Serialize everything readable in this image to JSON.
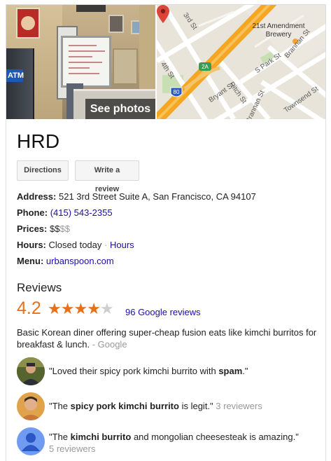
{
  "media": {
    "see_photos_label": "See photos",
    "atm_label": "ATM",
    "map": {
      "street_labels": [
        "3rd St",
        "4th St",
        "Bryant St",
        "Ritch St",
        "Brannan St",
        "S Park St",
        "Brannan St",
        "Townsend St"
      ],
      "place_name_line1": "21st Amendment",
      "place_name_line2": "Brewery",
      "highway_shield": "80",
      "route_shield": "2A"
    }
  },
  "business": {
    "name": "HRD",
    "actions": {
      "directions_label": "Directions",
      "write_review_label": "Write a review"
    },
    "address_label": "Address:",
    "address_value": "521 3rd Street Suite A, San Francisco, CA 94107",
    "phone_label": "Phone:",
    "phone_value": "(415) 543-2355",
    "prices_label": "Prices:",
    "prices_active": "$$",
    "prices_inactive": "$$",
    "hours_label": "Hours:",
    "hours_value": "Closed today",
    "hours_sep": "·",
    "hours_link": "Hours",
    "menu_label": "Menu:",
    "menu_value": "urbanspoon.com"
  },
  "reviews": {
    "heading": "Reviews",
    "rating": "4.2",
    "rating_value": 4.2,
    "stars_max": 5,
    "google_reviews_link": "96 Google reviews",
    "description": "Basic Korean diner offering super-cheap fusion eats like kimchi burritos for breakfast & lunch.",
    "description_source": "- Google",
    "snippets": [
      {
        "pre": "\"Loved their spicy pork kimchi burrito with ",
        "bold": "spam",
        "post": ".\"",
        "meta": ""
      },
      {
        "pre": "\"The ",
        "bold": "spicy pork kimchi burrito",
        "post": " is legit.\"",
        "meta": "3 reviewers"
      },
      {
        "pre": "\"The ",
        "bold": "kimchi burrito",
        "post": " and mongolian cheesesteak is amazing.\"",
        "meta": "5 reviewers"
      }
    ]
  },
  "colors": {
    "accent_orange": "#e7711b",
    "link_blue": "#1a0dab",
    "highway_orange": "#f5a623",
    "pin_red": "#db4437",
    "default_avatar_blue": "#4285f4"
  }
}
